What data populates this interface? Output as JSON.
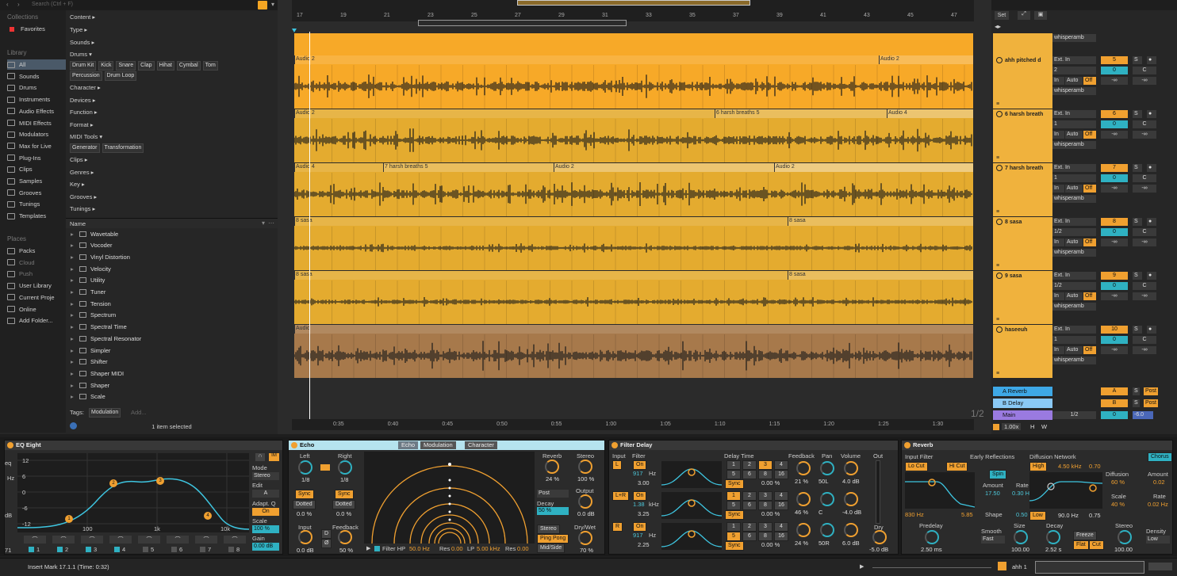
{
  "search": {
    "placeholder": "Search (Ctrl + F)"
  },
  "sidebar": {
    "collections_title": "Collections",
    "favorites": "Favorites",
    "library_title": "Library",
    "library": [
      "All",
      "Sounds",
      "Drums",
      "Instruments",
      "Audio Effects",
      "MIDI Effects",
      "Modulators",
      "Max for Live",
      "Plug-Ins",
      "Clips",
      "Samples",
      "Grooves",
      "Tunings",
      "Templates"
    ],
    "places_title": "Places",
    "places": [
      "Packs",
      "Cloud",
      "Push",
      "User Library",
      "Current Proje",
      "Online",
      "Add Folder..."
    ]
  },
  "filters": {
    "rows": [
      "Content ▸",
      "Type ▸",
      "Sounds ▸",
      "Drums ▾"
    ],
    "drum_tags": [
      "Drum Kit",
      "Kick",
      "Snare",
      "Clap",
      "Hihat",
      "Cymbal",
      "Tom"
    ],
    "drum_tags2": [
      "Percussion",
      "Drum Loop"
    ],
    "rows2": [
      "Character ▸",
      "Devices ▸",
      "Function ▸",
      "Format ▸",
      "MIDI Tools ▾"
    ],
    "midi_tags": [
      "Generator",
      "Transformation"
    ],
    "rows3": [
      "Clips ▸",
      "Genres ▸",
      "Key ▸",
      "Grooves ▸",
      "Tunings ▸"
    ]
  },
  "list": {
    "header": "Name",
    "items": [
      "Wavetable",
      "Vocoder",
      "Vinyl Distortion",
      "Velocity",
      "Utility",
      "Tuner",
      "Tension",
      "Spectrum",
      "Spectral Time",
      "Spectral Resonator",
      "Simpler",
      "Shifter",
      "Shaper MIDI",
      "Shaper",
      "Scale"
    ]
  },
  "tagbar": {
    "label": "Tags:",
    "tag": "Modulation",
    "add": "Add..."
  },
  "browser_status": "1 item selected",
  "ruler": [
    "17",
    "19",
    "21",
    "23",
    "25",
    "27",
    "29",
    "31",
    "33",
    "35",
    "37",
    "39",
    "41",
    "43",
    "45",
    "47"
  ],
  "timeline": [
    "0:35",
    "0:40",
    "0:45",
    "0:50",
    "0:55",
    "1:00",
    "1:05",
    "1:10",
    "1:15",
    "1:20",
    "1:25",
    "1:30"
  ],
  "page_indicator": "1/2",
  "tracks": [
    {
      "name": "ahh pitched d",
      "clips": [
        "Audio 2",
        "Audio 2"
      ],
      "input": "Ext. In",
      "ch": "2",
      "num": "5",
      "vol": "0",
      "pan": "C",
      "monitor": "whisperamb"
    },
    {
      "name": "6 harsh breath",
      "clips": [
        "Audio 2",
        "6 harsh breaths 5",
        "Audio 4"
      ],
      "input": "Ext. In",
      "ch": "1",
      "num": "6",
      "vol": "0",
      "pan": "C",
      "monitor": "whisperamb"
    },
    {
      "name": "7 harsh breath",
      "clips": [
        "Audio 4",
        "7 harsh breaths 5",
        "Audio 2",
        "Audio 2"
      ],
      "input": "Ext. In",
      "ch": "1",
      "num": "7",
      "vol": "0",
      "pan": "C",
      "monitor": "whisperamb"
    },
    {
      "name": "8 sasa",
      "clips": [
        "8 sasa",
        "8 sasa"
      ],
      "input": "Ext. In",
      "ch": "1/2",
      "num": "8",
      "vol": "0",
      "pan": "C",
      "monitor": "whisperamb"
    },
    {
      "name": "9 sasa",
      "clips": [
        "8 sasa",
        "8 sasa"
      ],
      "input": "Ext. In",
      "ch": "1/2",
      "num": "9",
      "vol": "0",
      "pan": "C",
      "monitor": "whisperamb"
    },
    {
      "name": "haseeuh",
      "clips": [
        "Audio"
      ],
      "input": "Ext. In",
      "ch": "1",
      "num": "10",
      "vol": "0",
      "pan": "C",
      "monitor": "whisperamb"
    }
  ],
  "mixer_labels": {
    "in": "In",
    "auto": "Auto",
    "off": "Off",
    "inf": "-∞",
    "s": "S",
    "set": "Set"
  },
  "returns": [
    {
      "name": "A Reverb",
      "letter": "A",
      "mode": "Post"
    },
    {
      "name": "B Delay",
      "letter": "B",
      "mode": "Post"
    },
    {
      "name": "Main",
      "letter": "1/2",
      "mode": "",
      "vol": "0",
      "db": "-6.0"
    }
  ],
  "zoom": "1.00x",
  "hw": [
    "H",
    "W"
  ],
  "eq": {
    "title": "EQ Eight",
    "yticks": [
      "12",
      "6",
      "0",
      "-6",
      "-12"
    ],
    "xticks": [
      "100",
      "1k",
      "10k"
    ],
    "mode_label": "Mode",
    "mode": "Stereo",
    "edit": "Edit",
    "edit_val": "A",
    "adapt": "Adapt. Q",
    "adapt_val": "On",
    "scale": "Scale",
    "scale_val": "100 %",
    "gain": "Gain",
    "gain_val": "0.00 dB",
    "bands": [
      "1",
      "2",
      "3",
      "4",
      "5",
      "6",
      "7",
      "8"
    ],
    "left_labels": [
      "eq",
      "Hz",
      "dB",
      "71"
    ]
  },
  "echo": {
    "title": "Echo",
    "tabs": [
      "Echo",
      "Modulation",
      "Character"
    ],
    "left": "Left",
    "right": "Right",
    "l_val": "1/8",
    "r_val": "1/8",
    "sync": "Sync",
    "dotted": "Dotted",
    "off": "0.0 %",
    "input": "Input",
    "input_val": "0.0 dB",
    "feedback": "Feedback",
    "fb_val": "50 %",
    "d": "D",
    "phase": "Ø",
    "reverb": "Reverb",
    "rv_val": "24 %",
    "stereo": "Stereo",
    "st_val": "100 %",
    "post": "Post",
    "decay": "Decay",
    "decay_val": "50 %",
    "output": "Output",
    "out_val": "0.0 dB",
    "stereo_btn": "Stereo",
    "pingpong": "Ping Pong",
    "midside": "Mid/Side",
    "drywet": "Dry/Wet",
    "dw_val": "70 %",
    "filter": "Filter HP",
    "hp": "50.0 Hz",
    "res": "Res",
    "res1": "0.00",
    "lp": "LP",
    "lp_val": "5.00 kHz",
    "res2": "0.00"
  },
  "fdelay": {
    "title": "Filter Delay",
    "input": "Input",
    "filter": "Filter",
    "l": "L",
    "lr": "L+R",
    "r": "R",
    "on": "On",
    "f1": "917",
    "hz": "Hz",
    "q1": "3.00",
    "f2": "1.38",
    "khz": "kHz",
    "q2": "3.25",
    "f3": "917",
    "q3": "2.25",
    "delay_time": "Delay Time",
    "grid": [
      "1",
      "2",
      "3",
      "4",
      "5",
      "6",
      "8",
      "16"
    ],
    "sync": "Sync",
    "pct": "0.00 %",
    "feedback": "Feedback",
    "pan": "Pan",
    "volume": "Volume",
    "out": "Out",
    "fbs": [
      "21 %",
      "46 %",
      "24 %"
    ],
    "pans": [
      "50L",
      "C",
      "50R"
    ],
    "vols": [
      "4.0 dB",
      "-4.0 dB",
      "6.0 dB"
    ],
    "dry": "Dry",
    "dry_val": "-5.0 dB"
  },
  "reverb": {
    "title": "Reverb",
    "input_filter": "Input Filter",
    "locut": "Lo Cut",
    "hicut": "Hi Cut",
    "freq": "830 Hz",
    "width": "5.85",
    "early": "Early Reflections",
    "spin": "Spin",
    "amount": "Amount",
    "amt_val": "17.50",
    "rate": "Rate",
    "rate_val": "0.30 Hz",
    "shape": "Shape",
    "shape_val": "0.50",
    "diffusion_net": "Diffusion Network",
    "high": "High",
    "hi_freq": "4.50 kHz",
    "hi_val": "0.70",
    "low": "Low",
    "lo_freq": "90.0 Hz",
    "lo_val": "0.75",
    "diffusion": "Diffusion",
    "diff_val": "60 %",
    "scale": "Scale",
    "scale_val": "40 %",
    "chorus": "Chorus",
    "c_amount": "Amount",
    "c_amt_val": "0.02",
    "c_rate": "Rate",
    "c_rate_val": "0.02 Hz",
    "predelay": "Predelay",
    "pd_val": "2.50 ms",
    "smooth": "Smooth",
    "smooth_val": "Fast",
    "size": "Size",
    "size_val": "100.00",
    "decay": "Decay",
    "decay_val": "2.52 s",
    "freeze": "Freeze",
    "flat": "Flat",
    "cut": "Cut",
    "stereo": "Stereo",
    "st_val": "100.00",
    "density": "Density",
    "density_val": "Low"
  },
  "status": {
    "text": "Insert Mark 17.1.1 (Time: 0:32)",
    "track": "ahh 1"
  },
  "colors": {
    "clip_orange": "#f7a928",
    "clip_gold": "#e4ab2f",
    "clip_brown": "#a7794b",
    "teal": "#2fb1c2",
    "orange": "#f0a030"
  }
}
